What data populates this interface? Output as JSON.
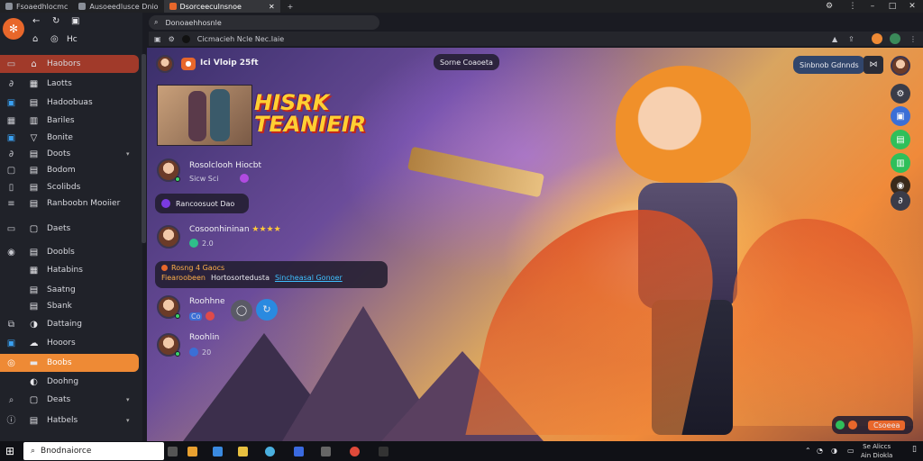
{
  "browser": {
    "tabs": [
      {
        "label": "Fsoaedhlocmc"
      },
      {
        "label": "Ausoeedlusce Dnio"
      },
      {
        "label": "Dsorceeculnsnoe"
      }
    ],
    "url": "Donoaehhosnle",
    "breadcrumb": "Cicmacieh Ncle Nec.Iaie"
  },
  "sidebar": {
    "top_label": "Hc",
    "items": [
      {
        "label": "Haobors",
        "icon": "home-icon"
      },
      {
        "label": "Laotts",
        "icon": "grid-icon"
      },
      {
        "label": "Hadoobuas",
        "icon": "book-icon"
      },
      {
        "label": "Bariles",
        "icon": "chat-icon"
      },
      {
        "label": "Bonite",
        "icon": "shield-icon"
      },
      {
        "label": "Doots",
        "icon": "flame-icon"
      },
      {
        "label": "Bodom",
        "icon": "star-icon"
      },
      {
        "label": "Scolibds",
        "icon": "calendar-icon"
      },
      {
        "label": "Ranboobn Mooiier",
        "icon": "people-icon"
      },
      {
        "label": "Daets",
        "icon": "clock-icon"
      },
      {
        "label": "Doobls",
        "icon": "chart-icon"
      },
      {
        "label": "Hatabins",
        "icon": "bell-icon"
      },
      {
        "label": "Saatng",
        "icon": "tag-icon"
      },
      {
        "label": "Sbank",
        "icon": "bolt-icon"
      },
      {
        "label": "Dattaing",
        "icon": "gear-icon"
      },
      {
        "label": "Hooors",
        "icon": "cloud-icon"
      },
      {
        "label": "Boobs",
        "icon": "flag-icon"
      },
      {
        "label": "Doohng",
        "icon": "music-icon"
      },
      {
        "label": "Deats",
        "icon": "search-icon"
      },
      {
        "label": "Hatbels",
        "icon": "info-icon"
      }
    ]
  },
  "stream": {
    "channel": "Ici Vloip 25ft",
    "banner_title": "HISRK TEANIEIR",
    "top_chip": "Sorne Coaoeta",
    "follow_chip": "Sinbnob Gdnnds"
  },
  "chat": [
    {
      "name": "Rosolclooh Hiocbt",
      "meta": "Sicw Sci"
    },
    {
      "name": "",
      "meta": "Rancoosuot Dao"
    },
    {
      "name": "Cosoonhininan",
      "meta": "2.0",
      "stars": "★★★★"
    },
    {
      "name": "Rosng 4 Gaocs",
      "meta": "Fiearoobeen",
      "highlight": "Hortosortedusta",
      "link": "Sincheasal Gonoer"
    },
    {
      "name": "Roohhne",
      "meta": "Co"
    },
    {
      "name": "Roohlin",
      "meta": "20"
    }
  ],
  "footer_chip": "Csoeea",
  "taskbar": {
    "search": "Bnodnaiorce",
    "clock_time": "Se Aliccs",
    "clock_date": "Ain Diokla"
  },
  "colors": {
    "accent_red": "#a13a2a",
    "accent_orange": "#ee8a35",
    "rail_blue": "#3b6fd6",
    "rail_green": "#2fbf5a"
  }
}
